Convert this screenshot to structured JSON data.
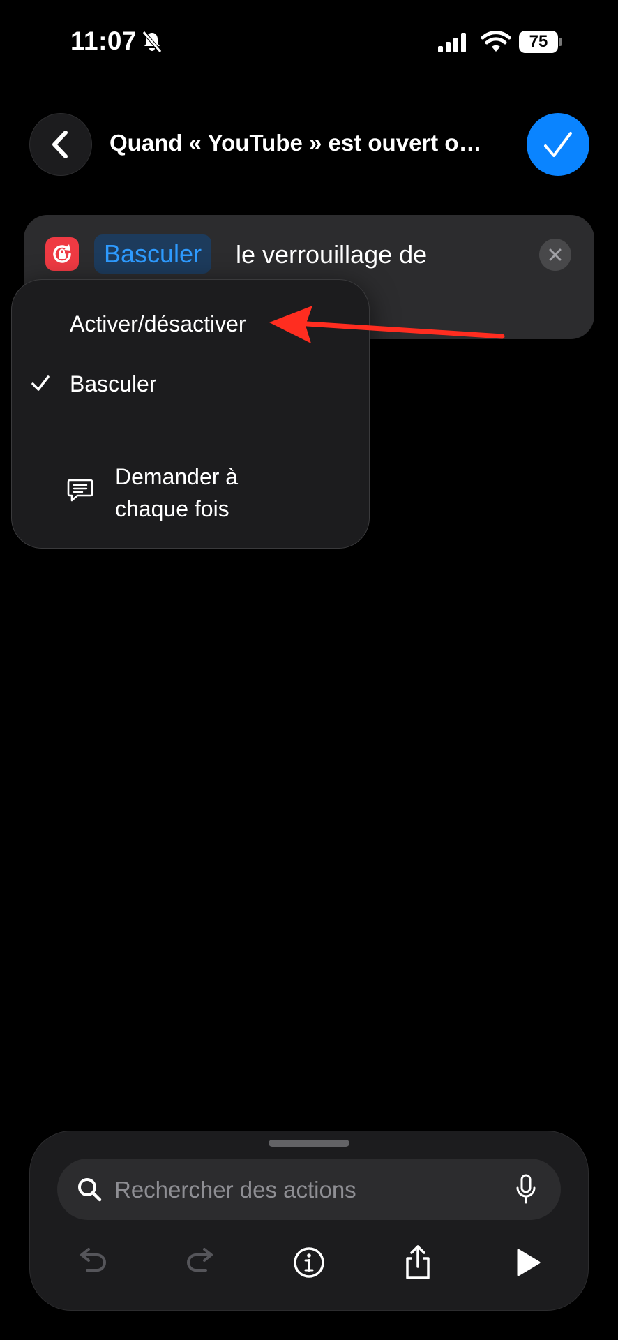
{
  "status_bar": {
    "time": "11:07",
    "battery": "75"
  },
  "header": {
    "title": "Quand « YouTube » est ouvert o…"
  },
  "action": {
    "token": "Basculer",
    "text": "le verrouillage de"
  },
  "menu": {
    "items": [
      {
        "label": "Activer/désactiver",
        "checked": false
      },
      {
        "label": "Basculer",
        "checked": true
      }
    ],
    "ask_label_line1": "Demander à",
    "ask_label_line2": "chaque fois"
  },
  "bottom": {
    "search_placeholder": "Rechercher des actions"
  },
  "colors": {
    "accent": "#0a84ff",
    "token_text": "#2e9bff",
    "action_icon": "#ef3a43",
    "annotation_arrow": "#ff2d20"
  }
}
